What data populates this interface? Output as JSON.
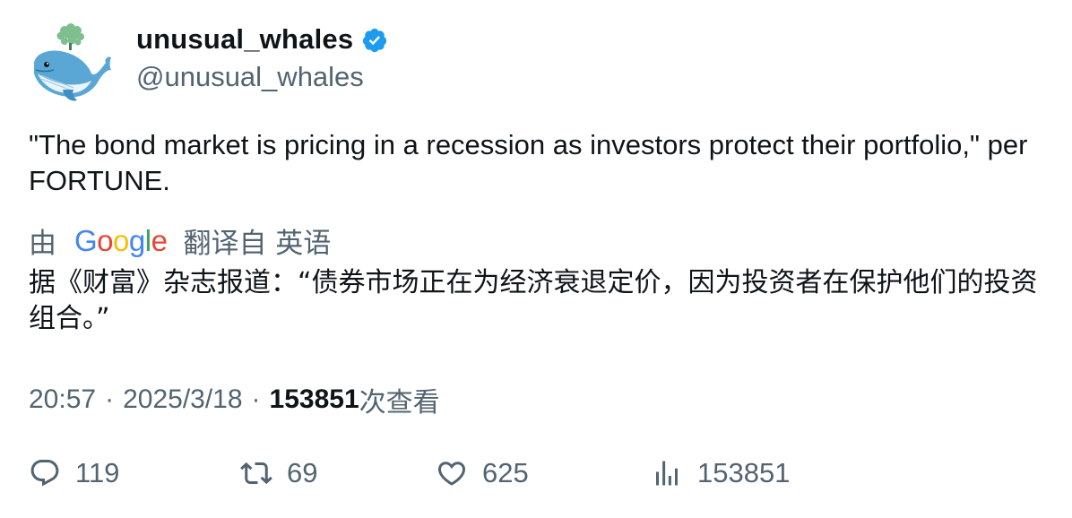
{
  "author": {
    "display_name": "unusual_whales",
    "handle": "@unusual_whales",
    "verified": true,
    "verified_color": "#1d9bf0"
  },
  "tweet": {
    "text": "\"The bond market is pricing in a recession as investors protect their portfolio,\" per FORTUNE."
  },
  "translation": {
    "prefix": "由",
    "provider_letters": [
      "G",
      "o",
      "o",
      "g",
      "l",
      "e"
    ],
    "suffix": "翻译自 英语",
    "text": "据《财富》杂志报道：“债券市场正在为经济衰退定价，因为投资者在保护他们的投资组合。”"
  },
  "meta": {
    "time": "20:57",
    "separator": "·",
    "date": "2025/3/18",
    "views_count": "153851",
    "views_label": "次查看"
  },
  "actions": {
    "replies": "119",
    "retweets": "69",
    "likes": "625",
    "views": "153851"
  },
  "colors": {
    "text_primary": "#0f1419",
    "text_secondary": "#536471",
    "google_blue": "#4285F4",
    "google_red": "#EA4335",
    "google_yellow": "#FBBC05",
    "google_green": "#34A853"
  },
  "icons": [
    "whale-avatar-icon",
    "verified-badge-icon",
    "reply-icon",
    "retweet-icon",
    "like-icon",
    "views-icon"
  ]
}
